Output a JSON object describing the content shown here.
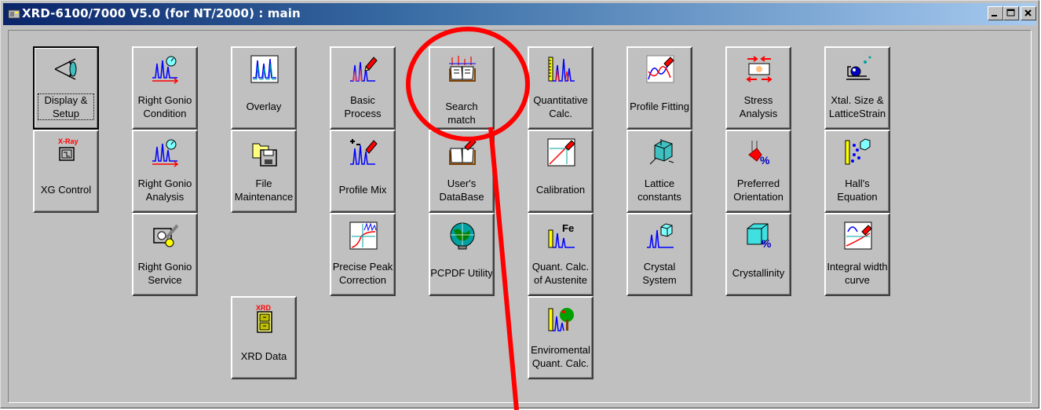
{
  "window": {
    "title": "XRD-6100/7000 V5.0 (for NT/2000) : main",
    "icon": "xrd-app-icon",
    "caption_buttons": [
      "minimize-icon",
      "maximize-icon",
      "close-icon"
    ]
  },
  "tiles": {
    "display_setup": {
      "label": "Display &\nSetup",
      "icon": "eye-icon"
    },
    "xg_control": {
      "label": "XG Control",
      "icon": "xray-generator-icon",
      "icon_text": "X-Ray"
    },
    "right_gonio_condition": {
      "label": "Right Gonio\nCondition",
      "icon": "gonio-peaks-icon"
    },
    "right_gonio_analysis": {
      "label": "Right Gonio\nAnalysis",
      "icon": "gonio-peaks-icon"
    },
    "right_gonio_service": {
      "label": "Right Gonio\nService",
      "icon": "service-tool-icon"
    },
    "overlay": {
      "label": "Overlay",
      "icon": "overlay-peaks-icon"
    },
    "file_maintenance": {
      "label": "File\nMaintenance",
      "icon": "folder-disk-icon"
    },
    "xrd_data": {
      "label": "XRD Data",
      "icon": "xrd-cabinet-icon",
      "icon_text": "XRD"
    },
    "basic_process": {
      "label": "Basic\nProcess",
      "icon": "peaks-pen-icon"
    },
    "profile_mix": {
      "label": "Profile Mix",
      "icon": "plus-minus-peaks-icon"
    },
    "precise_peak": {
      "label": "Precise Peak\nCorrection",
      "icon": "peak-correction-icon"
    },
    "search_match": {
      "label": "Search match",
      "icon": "book-search-icon"
    },
    "users_database": {
      "label": "User's\nDataBase",
      "icon": "book-pen-icon"
    },
    "pcpdf_utility": {
      "label": "PCPDF Utility",
      "icon": "globe-icon"
    },
    "quantitative": {
      "label": "Quantitative\nCalc.",
      "icon": "ruler-peaks-icon"
    },
    "calibration": {
      "label": "Calibration",
      "icon": "calibration-curve-icon"
    },
    "quant_austenite": {
      "label": "Quant. Calc.\nof Austenite",
      "icon": "fe-peaks-icon",
      "icon_text": "Fe"
    },
    "environmental": {
      "label": "Enviromental\nQuant. Calc.",
      "icon": "tree-peaks-icon"
    },
    "profile_fitting": {
      "label": "Profile Fitting",
      "icon": "fitting-curve-icon"
    },
    "lattice_constants": {
      "label": "Lattice\nconstants",
      "icon": "cube-axes-icon"
    },
    "crystal_system": {
      "label": "Crystal\nSystem",
      "icon": "cube-peaks-icon"
    },
    "stress_analysis": {
      "label": "Stress\nAnalysis",
      "icon": "stress-arrows-icon"
    },
    "preferred_orientation": {
      "label": "Preferred\nOrientation",
      "icon": "orientation-percent-icon"
    },
    "crystallinity": {
      "label": "Crystallinity",
      "icon": "cube-percent-icon"
    },
    "xtal_size": {
      "label": "Xtal. Size &\nLatticeStrain",
      "icon": "microscope-icon"
    },
    "halls_equation": {
      "label": "Hall's\nEquation",
      "icon": "dots-cube-icon"
    },
    "integral_width": {
      "label": "Integral width\ncurve",
      "icon": "width-curve-icon"
    }
  },
  "annotation": {
    "shape": "highlight-circle-with-pointer",
    "color": "#ff0000",
    "target": "Search match"
  }
}
